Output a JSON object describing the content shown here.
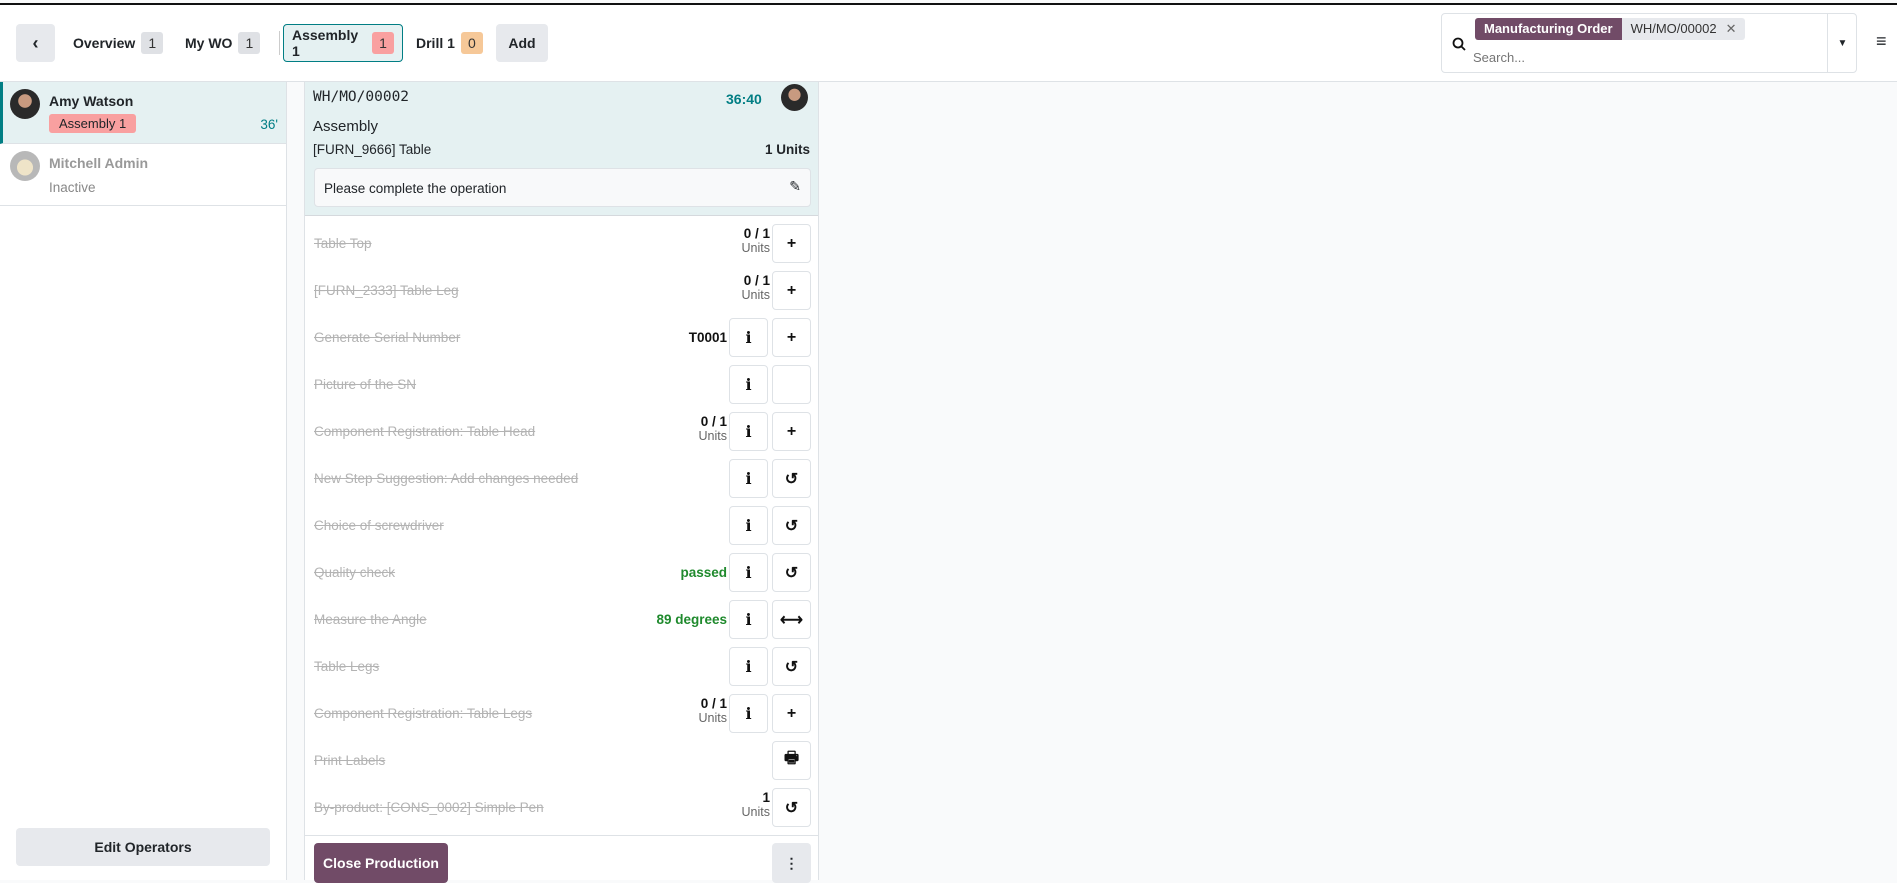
{
  "header": {
    "back_icon": "chevron-left-icon",
    "tabs": [
      {
        "label": "Overview",
        "count": "1",
        "color": "#dfe1e5"
      },
      {
        "label": "My WO",
        "count": "1",
        "color": "#dfe1e5"
      },
      {
        "label": "Assembly 1",
        "count": "1",
        "color": "#f9a0a0"
      },
      {
        "label": "Drill 1",
        "count": "0",
        "color": "#f6c898"
      }
    ],
    "add_label": "Add",
    "search": {
      "facet_label": "Manufacturing Order",
      "facet_value": "WH/MO/00002",
      "placeholder": "Search..."
    }
  },
  "operators": [
    {
      "name": "Amy Watson",
      "badge": "Assembly 1",
      "time": "36'"
    },
    {
      "name": "Mitchell Admin",
      "status": "Inactive"
    }
  ],
  "edit_operators_label": "Edit Operators",
  "workorder": {
    "reference": "WH/MO/00002",
    "timer": "36:40",
    "operation": "Assembly",
    "product": "[FURN_9666] Table",
    "quantity": "1 Units",
    "note": "Please complete the operation"
  },
  "steps": [
    {
      "label": "Table Top",
      "qty": "0 / 1",
      "unit": "Units",
      "info": false,
      "action": "+"
    },
    {
      "label": "[FURN_2333] Table Leg",
      "qty": "0 / 1",
      "unit": "Units",
      "info": false,
      "action": "+"
    },
    {
      "label": "Generate Serial Number",
      "value": "T0001",
      "info": true,
      "action": "+"
    },
    {
      "label": "Picture of the SN",
      "info": true,
      "action": ""
    },
    {
      "label": "Component Registration: Table Head",
      "qty": "0 / 1",
      "unit": "Units",
      "info": true,
      "action": "+"
    },
    {
      "label": "New Step Suggestion: Add changes needed",
      "info": true,
      "action": "↺"
    },
    {
      "label": "Choice of screwdriver",
      "info": true,
      "action": "↺"
    },
    {
      "label": "Quality check",
      "result": "passed",
      "info": true,
      "action": "↺"
    },
    {
      "label": "Measure the Angle",
      "result": "89 degrees",
      "info": true,
      "action": "⟷"
    },
    {
      "label": "Table Legs",
      "info": true,
      "action": "↺"
    },
    {
      "label": "Component Registration: Table Legs",
      "qty": "0 / 1",
      "unit": "Units",
      "info": true,
      "action": "+"
    },
    {
      "label": "Print Labels",
      "info": false,
      "action": "🖶"
    },
    {
      "label": "By-product: [CONS_0002] Simple Pen",
      "qty": "1",
      "unit": "Units",
      "info": false,
      "action": "↺"
    }
  ],
  "footer": {
    "close_label": "Close Production",
    "more_icon": "kebab-icon"
  },
  "colors": {
    "accent": "#017e84",
    "brand": "#714b67",
    "success": "#1f8a2d"
  }
}
